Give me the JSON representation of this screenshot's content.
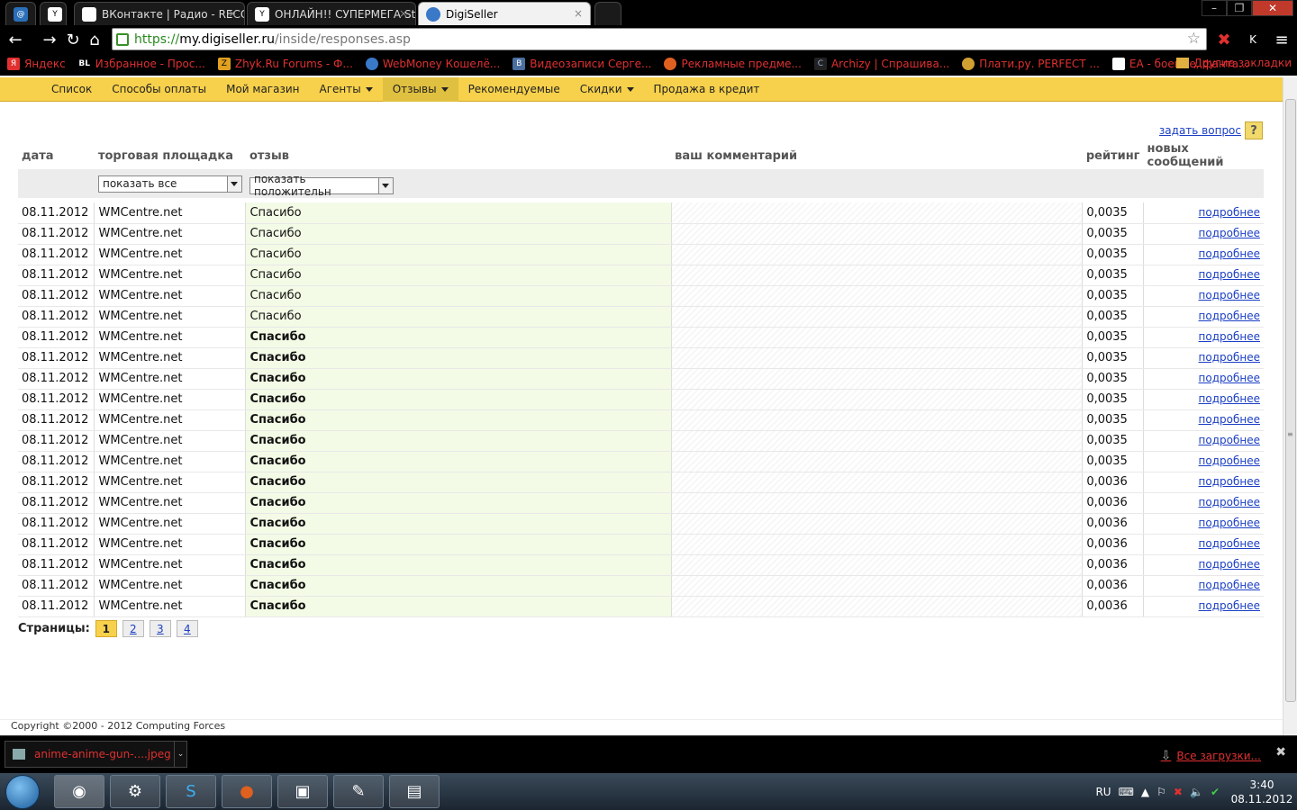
{
  "browser": {
    "tabs": [
      {
        "title": "",
        "icon": "at-icon"
      },
      {
        "title": "ВКонтакте | Радио - RECO",
        "icon": "page-icon"
      },
      {
        "title": "ОНЛАЙН!! СУПЕРМЕГА St",
        "icon": "youhack-icon"
      },
      {
        "title": "DigiSeller",
        "icon": "globe-icon",
        "active": true
      }
    ],
    "url": {
      "scheme": "https://",
      "host": "my.digiseller.ru",
      "path": "/inside/responses.asp"
    },
    "bookmarks": [
      {
        "label": "Яндекс",
        "icon": "yandex-icon"
      },
      {
        "label": "Избранное - Прос...",
        "icon": "bl-icon"
      },
      {
        "label": "Zhyk.Ru Forums - Ф...",
        "icon": "z-icon"
      },
      {
        "label": "WebMoney Кошелё...",
        "icon": "webmoney-icon"
      },
      {
        "label": "Видеозаписи Серге...",
        "icon": "vk-icon"
      },
      {
        "label": "Рекламные предме...",
        "icon": "origin-icon"
      },
      {
        "label": "Archizy | Спрашива...",
        "icon": "c-icon"
      },
      {
        "label": "Плати.ру. PERFECT ...",
        "icon": "plati-icon"
      },
      {
        "label": "EA - боевые, фанта...",
        "icon": "page-icon"
      }
    ],
    "other_bookmarks": "Другие закладки"
  },
  "menu": [
    {
      "label": "Список",
      "dropdown": false
    },
    {
      "label": "Способы оплаты",
      "dropdown": false
    },
    {
      "label": "Мой магазин",
      "dropdown": false
    },
    {
      "label": "Агенты",
      "dropdown": true
    },
    {
      "label": "Отзывы",
      "dropdown": true,
      "active": true
    },
    {
      "label": "Рекомендуемые",
      "dropdown": false
    },
    {
      "label": "Скидки",
      "dropdown": true
    },
    {
      "label": "Продажа в кредит",
      "dropdown": false
    }
  ],
  "ask_question": "задать вопрос",
  "ask_icon": "?",
  "table": {
    "headers": [
      "дата",
      "торговая площадка",
      "отзыв",
      "ваш комментарий",
      "рейтинг",
      "новых сообщений"
    ],
    "filters": {
      "site": "показать все",
      "review": "показать положительн"
    },
    "rows": [
      {
        "date": "08.11.2012",
        "site": "WMCentre.net",
        "review": "Спасибо",
        "bold": false,
        "rating": "0,0035",
        "more": "подробнее"
      },
      {
        "date": "08.11.2012",
        "site": "WMCentre.net",
        "review": "Спасибо",
        "bold": false,
        "rating": "0,0035",
        "more": "подробнее"
      },
      {
        "date": "08.11.2012",
        "site": "WMCentre.net",
        "review": "Спасибо",
        "bold": false,
        "rating": "0,0035",
        "more": "подробнее"
      },
      {
        "date": "08.11.2012",
        "site": "WMCentre.net",
        "review": "Спасибо",
        "bold": false,
        "rating": "0,0035",
        "more": "подробнее"
      },
      {
        "date": "08.11.2012",
        "site": "WMCentre.net",
        "review": "Спасибо",
        "bold": false,
        "rating": "0,0035",
        "more": "подробнее"
      },
      {
        "date": "08.11.2012",
        "site": "WMCentre.net",
        "review": "Спасибо",
        "bold": false,
        "rating": "0,0035",
        "more": "подробнее"
      },
      {
        "date": "08.11.2012",
        "site": "WMCentre.net",
        "review": "Спасибо",
        "bold": true,
        "rating": "0,0035",
        "more": "подробнее"
      },
      {
        "date": "08.11.2012",
        "site": "WMCentre.net",
        "review": "Спасибо",
        "bold": true,
        "rating": "0,0035",
        "more": "подробнее"
      },
      {
        "date": "08.11.2012",
        "site": "WMCentre.net",
        "review": "Спасибо",
        "bold": true,
        "rating": "0,0035",
        "more": "подробнее"
      },
      {
        "date": "08.11.2012",
        "site": "WMCentre.net",
        "review": "Спасибо",
        "bold": true,
        "rating": "0,0035",
        "more": "подробнее"
      },
      {
        "date": "08.11.2012",
        "site": "WMCentre.net",
        "review": "Спасибо",
        "bold": true,
        "rating": "0,0035",
        "more": "подробнее"
      },
      {
        "date": "08.11.2012",
        "site": "WMCentre.net",
        "review": "Спасибо",
        "bold": true,
        "rating": "0,0035",
        "more": "подробнее"
      },
      {
        "date": "08.11.2012",
        "site": "WMCentre.net",
        "review": "Спасибо",
        "bold": true,
        "rating": "0,0035",
        "more": "подробнее"
      },
      {
        "date": "08.11.2012",
        "site": "WMCentre.net",
        "review": "Спасибо",
        "bold": true,
        "rating": "0,0036",
        "more": "подробнее"
      },
      {
        "date": "08.11.2012",
        "site": "WMCentre.net",
        "review": "Спасибо",
        "bold": true,
        "rating": "0,0036",
        "more": "подробнее"
      },
      {
        "date": "08.11.2012",
        "site": "WMCentre.net",
        "review": "Спасибо",
        "bold": true,
        "rating": "0,0036",
        "more": "подробнее"
      },
      {
        "date": "08.11.2012",
        "site": "WMCentre.net",
        "review": "Спасибо",
        "bold": true,
        "rating": "0,0036",
        "more": "подробнее"
      },
      {
        "date": "08.11.2012",
        "site": "WMCentre.net",
        "review": "Спасибо",
        "bold": true,
        "rating": "0,0036",
        "more": "подробнее"
      },
      {
        "date": "08.11.2012",
        "site": "WMCentre.net",
        "review": "Спасибо",
        "bold": true,
        "rating": "0,0036",
        "more": "подробнее"
      },
      {
        "date": "08.11.2012",
        "site": "WMCentre.net",
        "review": "Спасибо",
        "bold": true,
        "rating": "0,0036",
        "more": "подробнее"
      }
    ]
  },
  "pagination": {
    "label": "Страницы:",
    "pages": [
      "1",
      "2",
      "3",
      "4"
    ],
    "current": "1"
  },
  "copyright": "Copyright ©2000 - 2012 Computing Forces",
  "downloads": {
    "file": "anime-anime-gun-....jpeg",
    "all": "Все загрузки..."
  },
  "taskbar": {
    "lang": "RU",
    "time": "3:40",
    "date": "08.11.2012"
  },
  "colors": {
    "menu_bg": "#f7d14b",
    "link": "#1b3fc4",
    "review_bg": "#f3fbe6"
  }
}
